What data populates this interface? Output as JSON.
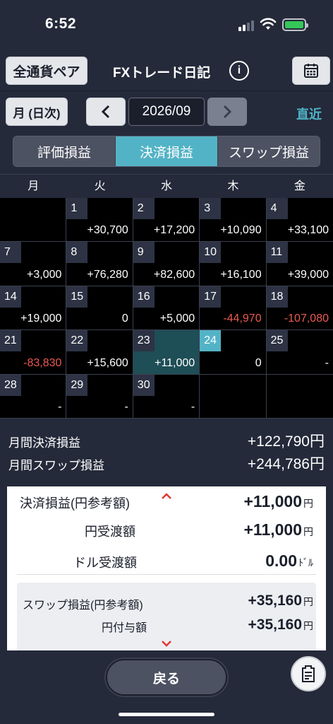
{
  "status": {
    "time": "6:52"
  },
  "header": {
    "pair_button": "全通貨ペア",
    "title": "FXトレード日記",
    "info_icon": "i"
  },
  "nav": {
    "mode_button": "月 (日次)",
    "month": "2026/09",
    "latest": "直近"
  },
  "tabs": [
    "評価損益",
    "決済損益",
    "スワップ損益"
  ],
  "active_tab": 1,
  "weekdays": [
    "月",
    "火",
    "水",
    "木",
    "金"
  ],
  "calendar": [
    {
      "day": "",
      "value": ""
    },
    {
      "day": "1",
      "value": "+30,700"
    },
    {
      "day": "2",
      "value": "+17,200"
    },
    {
      "day": "3",
      "value": "+10,090"
    },
    {
      "day": "4",
      "value": "+33,100"
    },
    {
      "day": "7",
      "value": "+3,000"
    },
    {
      "day": "8",
      "value": "+76,280"
    },
    {
      "day": "9",
      "value": "+82,600"
    },
    {
      "day": "10",
      "value": "+16,100"
    },
    {
      "day": "11",
      "value": "+39,000"
    },
    {
      "day": "14",
      "value": "+19,000"
    },
    {
      "day": "15",
      "value": "0"
    },
    {
      "day": "16",
      "value": "+5,000"
    },
    {
      "day": "17",
      "value": "-44,970"
    },
    {
      "day": "18",
      "value": "-107,080"
    },
    {
      "day": "21",
      "value": "-83,830"
    },
    {
      "day": "22",
      "value": "+15,600"
    },
    {
      "day": "23",
      "value": "+11,000"
    },
    {
      "day": "24",
      "value": "0"
    },
    {
      "day": "25",
      "value": "-"
    },
    {
      "day": "28",
      "value": "-"
    },
    {
      "day": "29",
      "value": "-"
    },
    {
      "day": "30",
      "value": "-"
    },
    {
      "day": "",
      "value": ""
    },
    {
      "day": "",
      "value": ""
    }
  ],
  "selected_day": "23",
  "today": "24",
  "summary": {
    "settled_label": "月間決済損益",
    "settled_value": "+122,790円",
    "swap_label": "月間スワップ損益",
    "swap_value": "+244,786円"
  },
  "detail": {
    "settled_ref_label": "決済損益(円参考額)",
    "settled_ref_value": "+11,000",
    "settled_ref_unit": "円",
    "jpy_label": "円受渡額",
    "jpy_value": "+11,000",
    "jpy_unit": "円",
    "usd_label": "ドル受渡額",
    "usd_value": "0.00",
    "usd_unit": "ﾄﾞﾙ",
    "swap_ref_label": "スワップ損益(円参考額)",
    "swap_ref_value": "+35,160",
    "swap_ref_unit": "円",
    "jpy_grant_label": "円付与額",
    "jpy_grant_value": "+35,160",
    "jpy_grant_unit": "円"
  },
  "bottom": {
    "back_button": "戻る"
  },
  "colors": {
    "accent": "#53b3c6",
    "negative": "#ea5a52",
    "background": "#242a3a"
  }
}
